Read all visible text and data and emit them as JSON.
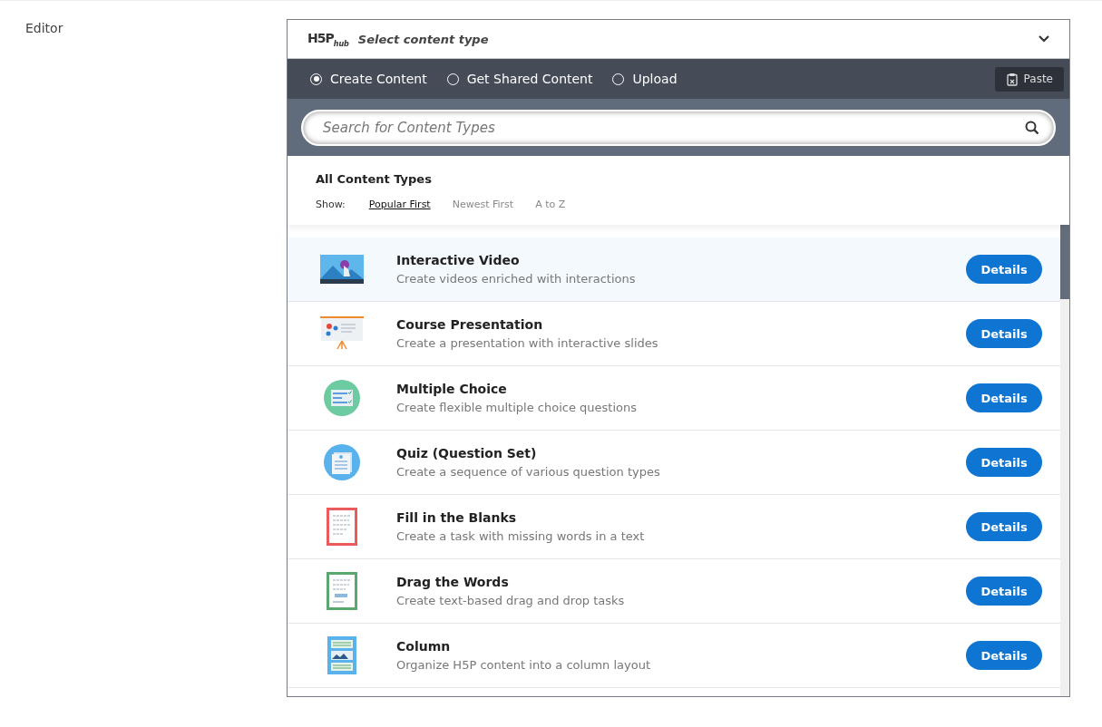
{
  "field_label": "Editor",
  "hub": {
    "logo": "H5P",
    "logo_sub": "hub",
    "title": "Select content type",
    "expanded": true
  },
  "tabs": [
    {
      "label": "Create Content",
      "selected": true
    },
    {
      "label": "Get Shared Content",
      "selected": false
    },
    {
      "label": "Upload",
      "selected": false
    }
  ],
  "paste_button": "Paste",
  "search": {
    "placeholder": "Search for Content Types"
  },
  "section_title": "All Content Types",
  "sort": {
    "label": "Show:",
    "options": [
      {
        "label": "Popular First",
        "selected": true
      },
      {
        "label": "Newest First",
        "selected": false
      },
      {
        "label": "A to Z",
        "selected": false
      }
    ]
  },
  "content_types": [
    {
      "kind": "video",
      "title": "Interactive Video",
      "description": "Create videos enriched with interactions",
      "button": "Details",
      "selected": true
    },
    {
      "kind": "presentation",
      "title": "Course Presentation",
      "description": "Create a presentation with interactive slides",
      "button": "Details",
      "selected": false
    },
    {
      "kind": "choice",
      "title": "Multiple Choice",
      "description": "Create flexible multiple choice questions",
      "button": "Details",
      "selected": false
    },
    {
      "kind": "quiz",
      "title": "Quiz (Question Set)",
      "description": "Create a sequence of various question types",
      "button": "Details",
      "selected": false
    },
    {
      "kind": "blanks",
      "title": "Fill in the Blanks",
      "description": "Create a task with missing words in a text",
      "button": "Details",
      "selected": false
    },
    {
      "kind": "drag",
      "title": "Drag the Words",
      "description": "Create text-based drag and drop tasks",
      "button": "Details",
      "selected": false
    },
    {
      "kind": "column",
      "title": "Column",
      "description": "Organize H5P content into a column layout",
      "button": "Details",
      "selected": false
    }
  ]
}
